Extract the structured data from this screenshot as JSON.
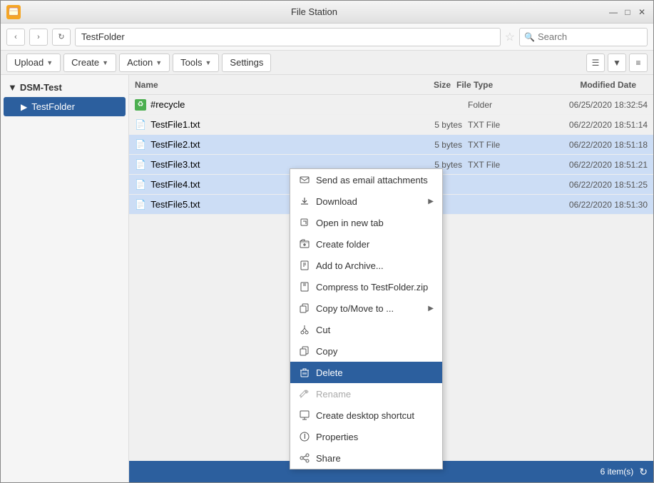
{
  "window": {
    "title": "File Station",
    "icon": "🗂"
  },
  "titlebar": {
    "title": "File Station",
    "controls": [
      "—",
      "□",
      "✕"
    ]
  },
  "addressbar": {
    "path": "TestFolder",
    "search_placeholder": "Search"
  },
  "toolbar": {
    "upload_label": "Upload",
    "create_label": "Create",
    "action_label": "Action",
    "tools_label": "Tools",
    "settings_label": "Settings"
  },
  "sidebar": {
    "section": "DSM-Test",
    "items": [
      {
        "label": "TestFolder",
        "active": true
      }
    ]
  },
  "file_list": {
    "columns": {
      "name": "Name",
      "size": "Size",
      "type": "File Type",
      "date": "Modified Date"
    },
    "rows": [
      {
        "name": "#recycle",
        "size": "",
        "type": "Folder",
        "date": "06/25/2020 18:32:54",
        "icon": "recycle"
      },
      {
        "name": "TestFile1.txt",
        "size": "5 bytes",
        "type": "TXT File",
        "date": "06/22/2020 18:51:14",
        "icon": "txt"
      },
      {
        "name": "TestFile2.txt",
        "size": "5 bytes",
        "type": "TXT File",
        "date": "06/22/2020 18:51:18",
        "icon": "txt",
        "selected": true
      },
      {
        "name": "TestFile3.txt",
        "size": "5 bytes",
        "type": "TXT File",
        "date": "06/22/2020 18:51:21",
        "icon": "txt",
        "selected": true
      },
      {
        "name": "TestFile4.txt",
        "size": "",
        "type": "",
        "date": "06/22/2020 18:51:25",
        "icon": "txt",
        "selected": true
      },
      {
        "name": "TestFile5.txt",
        "size": "",
        "type": "",
        "date": "06/22/2020 18:51:30",
        "icon": "txt",
        "selected": true
      }
    ]
  },
  "status": {
    "count": "6 item(s)"
  },
  "context_menu": {
    "items": [
      {
        "label": "Send as email attachments",
        "icon": "✉",
        "id": "send-email",
        "disabled": false,
        "has_arrow": false
      },
      {
        "label": "Download",
        "icon": "⬇",
        "id": "download",
        "disabled": false,
        "has_arrow": true
      },
      {
        "label": "Open in new tab",
        "icon": "➕",
        "id": "open-new-tab",
        "disabled": false,
        "has_arrow": false
      },
      {
        "label": "Create folder",
        "icon": "➕",
        "id": "create-folder",
        "disabled": false,
        "has_arrow": false
      },
      {
        "label": "Add to Archive...",
        "icon": "📦",
        "id": "add-archive",
        "disabled": false,
        "has_arrow": false
      },
      {
        "label": "Compress to TestFolder.zip",
        "icon": "🗜",
        "id": "compress",
        "disabled": false,
        "has_arrow": false
      },
      {
        "label": "Copy to/Move to ...",
        "icon": "📋",
        "id": "copy-move",
        "disabled": false,
        "has_arrow": true
      },
      {
        "label": "Cut",
        "icon": "✂",
        "id": "cut",
        "disabled": false,
        "has_arrow": false
      },
      {
        "label": "Copy",
        "icon": "📄",
        "id": "copy",
        "disabled": false,
        "has_arrow": false
      },
      {
        "label": "Delete",
        "icon": "🗑",
        "id": "delete",
        "disabled": false,
        "has_arrow": false,
        "active": true
      },
      {
        "label": "Rename",
        "icon": "✏",
        "id": "rename",
        "disabled": true,
        "has_arrow": false
      },
      {
        "label": "Create desktop shortcut",
        "icon": "🖥",
        "id": "desktop-shortcut",
        "disabled": false,
        "has_arrow": false
      },
      {
        "label": "Properties",
        "icon": "ℹ",
        "id": "properties",
        "disabled": false,
        "has_arrow": false
      },
      {
        "label": "Share",
        "icon": "↗",
        "id": "share",
        "disabled": false,
        "has_arrow": false
      }
    ]
  }
}
